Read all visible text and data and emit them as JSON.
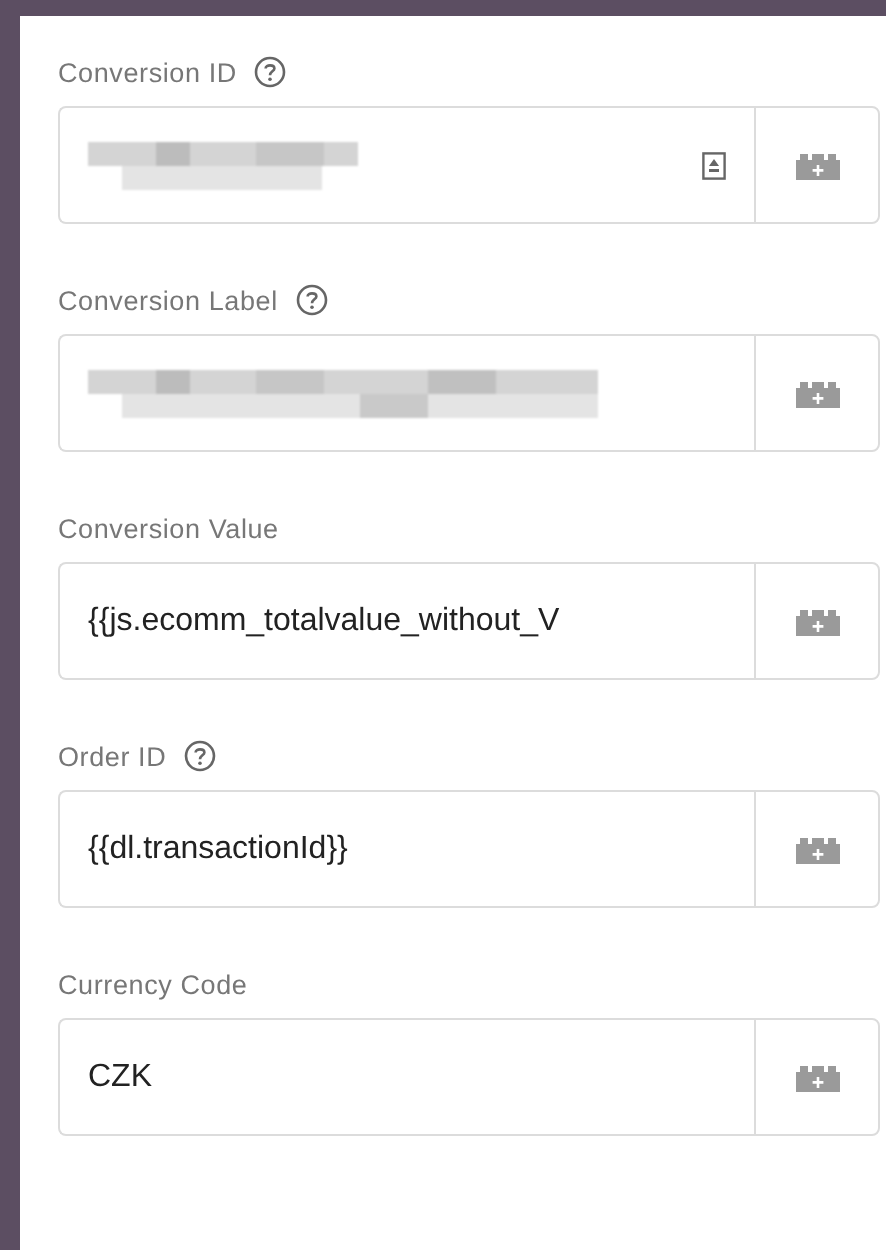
{
  "fields": [
    {
      "label": "Conversion ID",
      "help": true,
      "value": {
        "kind": "redacted"
      },
      "lookup_icon": true
    },
    {
      "label": "Conversion Label",
      "help": true,
      "value": {
        "kind": "redacted"
      },
      "lookup_icon": false
    },
    {
      "label": "Conversion Value",
      "help": false,
      "value": {
        "kind": "text",
        "text": "{{js.ecomm_totalvalue_without_V"
      },
      "lookup_icon": false
    },
    {
      "label": "Order ID",
      "help": true,
      "value": {
        "kind": "text",
        "text": "{{dl.transactionId}}"
      },
      "lookup_icon": false
    },
    {
      "label": "Currency Code",
      "help": false,
      "value": {
        "kind": "text",
        "text": "CZK"
      },
      "lookup_icon": false
    }
  ]
}
